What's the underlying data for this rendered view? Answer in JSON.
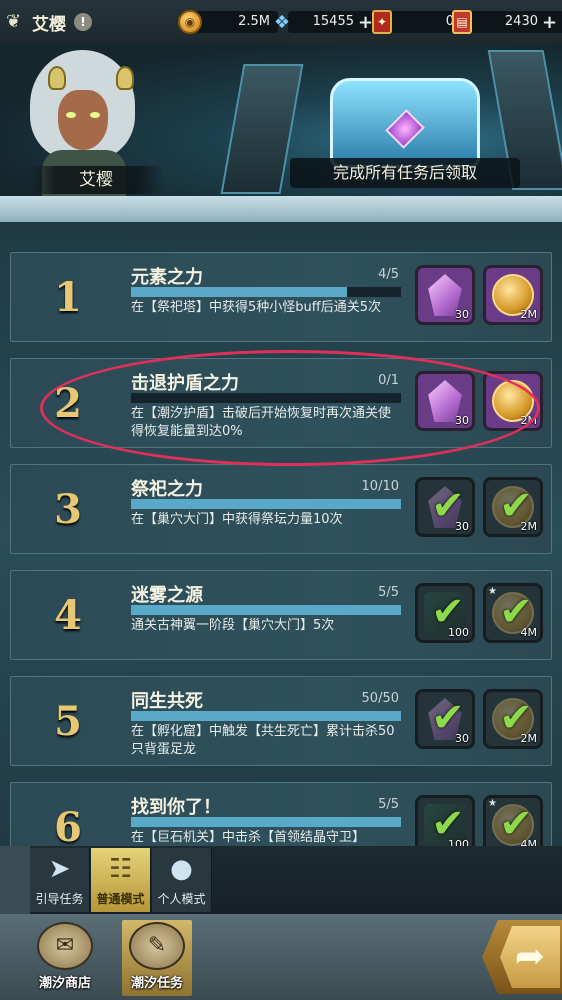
{
  "player": {
    "name": "艾樱",
    "alert": "!"
  },
  "resources": [
    {
      "icon": "gold-coin-icon",
      "value": "2.5M",
      "plus": false
    },
    {
      "icon": "blue-crystal-icon",
      "value": "15455",
      "plus": true
    },
    {
      "icon": "red-card-icon",
      "value": "0",
      "plus": false
    },
    {
      "icon": "red-ticket-icon",
      "value": "2430",
      "plus": true
    }
  ],
  "hero": {
    "character_name": "艾樱",
    "chest_tip": "完成所有任务后领取"
  },
  "tasks": [
    {
      "num": "1",
      "title": "元素之力",
      "progress": "4/5",
      "fraction": 0.8,
      "desc": "在【祭祀塔】中获得5种小怪buff后通关5次",
      "rewards": [
        {
          "type": "crystal",
          "qty": "30",
          "claimed": false
        },
        {
          "type": "coin",
          "qty": "2M",
          "claimed": false
        }
      ]
    },
    {
      "num": "2",
      "title": "击退护盾之力",
      "progress": "0/1",
      "fraction": 0.0,
      "desc": "在【潮汐护盾】击破后开始恢复时再次通关使得恢复能量到达0%",
      "rewards": [
        {
          "type": "crystal",
          "qty": "30",
          "claimed": false
        },
        {
          "type": "coin",
          "qty": "2M",
          "claimed": false
        }
      ]
    },
    {
      "num": "3",
      "title": "祭祀之力",
      "progress": "10/10",
      "fraction": 1.0,
      "desc": "在【巢穴大门】中获得祭坛力量10次",
      "rewards": [
        {
          "type": "crystal",
          "qty": "30",
          "claimed": true
        },
        {
          "type": "coin",
          "qty": "2M",
          "claimed": true
        }
      ]
    },
    {
      "num": "4",
      "title": "迷雾之源",
      "progress": "5/5",
      "fraction": 1.0,
      "desc": "通关古神翼一阶段【巢穴大门】5次",
      "rewards": [
        {
          "type": "dark",
          "qty": "100",
          "claimed": true
        },
        {
          "type": "coin",
          "qty": "4M",
          "claimed": true
        }
      ]
    },
    {
      "num": "5",
      "title": "同生共死",
      "progress": "50/50",
      "fraction": 1.0,
      "desc": "在【孵化窟】中触发【共生死亡】累计击杀50只背蛋足龙",
      "rewards": [
        {
          "type": "crystal",
          "qty": "30",
          "claimed": true
        },
        {
          "type": "coin",
          "qty": "2M",
          "claimed": true
        }
      ]
    },
    {
      "num": "6",
      "title": "找到你了！",
      "progress": "5/5",
      "fraction": 1.0,
      "desc": "在【巨石机关】中击杀【首领结晶守卫】",
      "rewards": [
        {
          "type": "dark",
          "qty": "100",
          "claimed": true
        },
        {
          "type": "coin",
          "qty": "4M",
          "claimed": true
        }
      ]
    }
  ],
  "modes": [
    {
      "label": "引导任务",
      "icon": "paper-plane-icon",
      "active": false
    },
    {
      "label": "普通模式",
      "icon": "clipboard-icon",
      "active": true
    },
    {
      "label": "个人模式",
      "icon": "person-icon",
      "active": false
    }
  ],
  "nav": [
    {
      "label": "潮汐商店",
      "icon": "shop-scroll-icon",
      "active": false
    },
    {
      "label": "潮汐任务",
      "icon": "quest-scroll-icon",
      "active": true
    }
  ],
  "colors": {
    "accent_gold": "#e6c874",
    "progress": "#5aa9c8",
    "check": "#8ed94a",
    "highlight": "#e0305a"
  }
}
